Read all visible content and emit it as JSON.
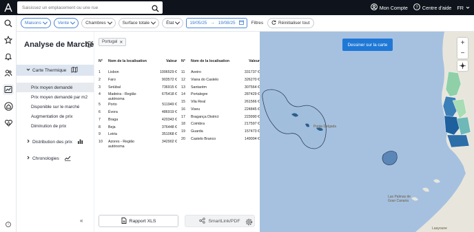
{
  "topbar": {
    "search_placeholder": "Saisissez un emplacement ou une rue",
    "account_label": "Mon Compte",
    "help_label": "Centre d'aide",
    "language": "FR"
  },
  "filters": {
    "chips": [
      {
        "label": "Maisons",
        "active": true
      },
      {
        "label": "Vente",
        "active": true
      },
      {
        "label": "Chambres",
        "active": false
      },
      {
        "label": "Surface totale",
        "active": false
      },
      {
        "label": "État",
        "active": false
      }
    ],
    "date_from": "19/05/25",
    "date_to": "19/08/25",
    "filters_label": "Filtres",
    "reset_label": "Réinitialiser tout"
  },
  "panel": {
    "title": "Analyse de Marché",
    "sections": [
      {
        "label": "Carte Thermique",
        "open": true,
        "items": [
          "Prix moyen demandé",
          "Prix moyen demandé par m2",
          "Disponible sur le marché",
          "Augmentation de prix",
          "Diminution de prix"
        ]
      },
      {
        "label": "Distribution des prix",
        "open": false
      },
      {
        "label": "Chronologies",
        "open": false
      }
    ]
  },
  "table": {
    "tag": "Portugal",
    "headers": {
      "n": "N°",
      "name": "Nom de la localisation",
      "value": "Valeur"
    },
    "left": [
      {
        "n": "1",
        "name": "Lisbon",
        "value": "1006529 €"
      },
      {
        "n": "2",
        "name": "Faro",
        "value": "903572 €"
      },
      {
        "n": "3",
        "name": "Setúbal",
        "value": "736915 €"
      },
      {
        "n": "4",
        "name": "Madeira - Região autónoma",
        "value": "675418 €"
      },
      {
        "n": "5",
        "name": "Porto",
        "value": "511949 €"
      },
      {
        "n": "6",
        "name": "Évora",
        "value": "486919 €"
      },
      {
        "n": "7",
        "name": "Braga",
        "value": "420343 €"
      },
      {
        "n": "8",
        "name": "Beja",
        "value": "376448 €"
      },
      {
        "n": "9",
        "name": "Leiria",
        "value": "351068 €"
      },
      {
        "n": "10",
        "name": "Azores - Região autónoma",
        "value": "342902 €"
      }
    ],
    "right": [
      {
        "n": "11",
        "name": "Aveiro",
        "value": "331737 €"
      },
      {
        "n": "12",
        "name": "Viana do Castelo",
        "value": "326270 €"
      },
      {
        "n": "13",
        "name": "Santarém",
        "value": "307564 €"
      },
      {
        "n": "14",
        "name": "Portalegre",
        "value": "287429 €"
      },
      {
        "n": "15",
        "name": "Vila Real",
        "value": "261566 €"
      },
      {
        "n": "16",
        "name": "Viseu",
        "value": "224845 €"
      },
      {
        "n": "17",
        "name": "Bragança District",
        "value": "223990 €"
      },
      {
        "n": "18",
        "name": "Coimbra",
        "value": "217597 €"
      },
      {
        "n": "19",
        "name": "Guarda",
        "value": "157473 €"
      },
      {
        "n": "20",
        "name": "Castelo Branco",
        "value": "149004 €"
      }
    ]
  },
  "buttons": {
    "xls": "Rapport XLS",
    "smartlink": "SmartLink/PDF"
  },
  "map": {
    "draw_button": "Dessiner sur la carte",
    "labels": {
      "ponta_delgada": "Ponta Delgada",
      "las_palmas": "Las Palmas de Gran Canaria",
      "laayoune": "Laayoune"
    },
    "colors": {
      "sea": "#a6c1e0",
      "land": "#e8e6dc",
      "heat_high": "#1e5f9e",
      "heat_low": "#8fd0a8"
    }
  },
  "icons": [
    "logo-icon",
    "search-icon",
    "user-icon",
    "help-icon",
    "star-icon",
    "bell-icon",
    "people-icon",
    "chart-icon",
    "house-icon",
    "heart-house-icon",
    "info-icon",
    "calendar-icon",
    "refresh-icon",
    "file-icon",
    "link-icon",
    "gear-icon"
  ]
}
